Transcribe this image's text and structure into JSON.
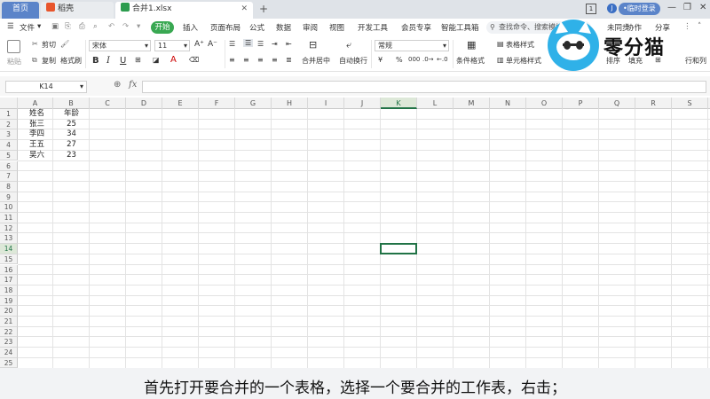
{
  "tabs": [
    {
      "label": "首页"
    },
    {
      "label": "稻壳"
    },
    {
      "label": "合并1.xlsx"
    }
  ],
  "title_right": {
    "badge": "1",
    "avatar": "J",
    "login": "•临时登录"
  },
  "menu": {
    "file": "文件",
    "items": [
      "开始",
      "插入",
      "页面布局",
      "公式",
      "数据",
      "审阅",
      "视图",
      "开发工具",
      "会员专享",
      "智能工具箱"
    ],
    "search_placeholder": "查找命令、搜索模板",
    "sync": "未同步",
    "collab": "协作",
    "share": "分享"
  },
  "ribbon": {
    "paste": "粘贴",
    "cut": "剪切",
    "copy": "复制",
    "format_painter": "格式刷",
    "font_name": "宋体",
    "font_size": "11",
    "bold": "B",
    "italic": "I",
    "underline": "U",
    "merge_center": "合并居中",
    "wrap_text": "自动换行",
    "number_format": "常规",
    "currency": "¥",
    "percent": "%",
    "cond_format": "条件格式",
    "table_style": "表格样式",
    "cell_style": "单元格样式",
    "sort": "排序",
    "fill": "填充",
    "row_col": "行和列"
  },
  "formula_bar": {
    "cell_ref": "K14",
    "fx": "fx",
    "content": ""
  },
  "columns": [
    "A",
    "B",
    "C",
    "D",
    "E",
    "F",
    "G",
    "H",
    "I",
    "J",
    "K",
    "L",
    "M",
    "N",
    "O",
    "P",
    "Q",
    "R",
    "S"
  ],
  "rows": [
    "1",
    "2",
    "3",
    "4",
    "5",
    "6",
    "7",
    "8",
    "9",
    "10",
    "11",
    "12",
    "13",
    "14",
    "15",
    "16",
    "17",
    "18",
    "19",
    "20",
    "21",
    "22",
    "23",
    "24",
    "25"
  ],
  "cells": [
    [
      "姓名",
      "年龄"
    ],
    [
      "张三",
      "25"
    ],
    [
      "李四",
      "34"
    ],
    [
      "王五",
      "27"
    ],
    [
      "吴六",
      "23"
    ]
  ],
  "active_cell": {
    "column": "K",
    "row": "14"
  },
  "logo_text": "零分猫",
  "subtitle": "首先打开要合并的一个表格，选择一个要合并的工作表，右击；",
  "colors": {
    "accent_green": "#217346",
    "start_green": "#39a852",
    "tab_blue": "#5b84c9"
  }
}
